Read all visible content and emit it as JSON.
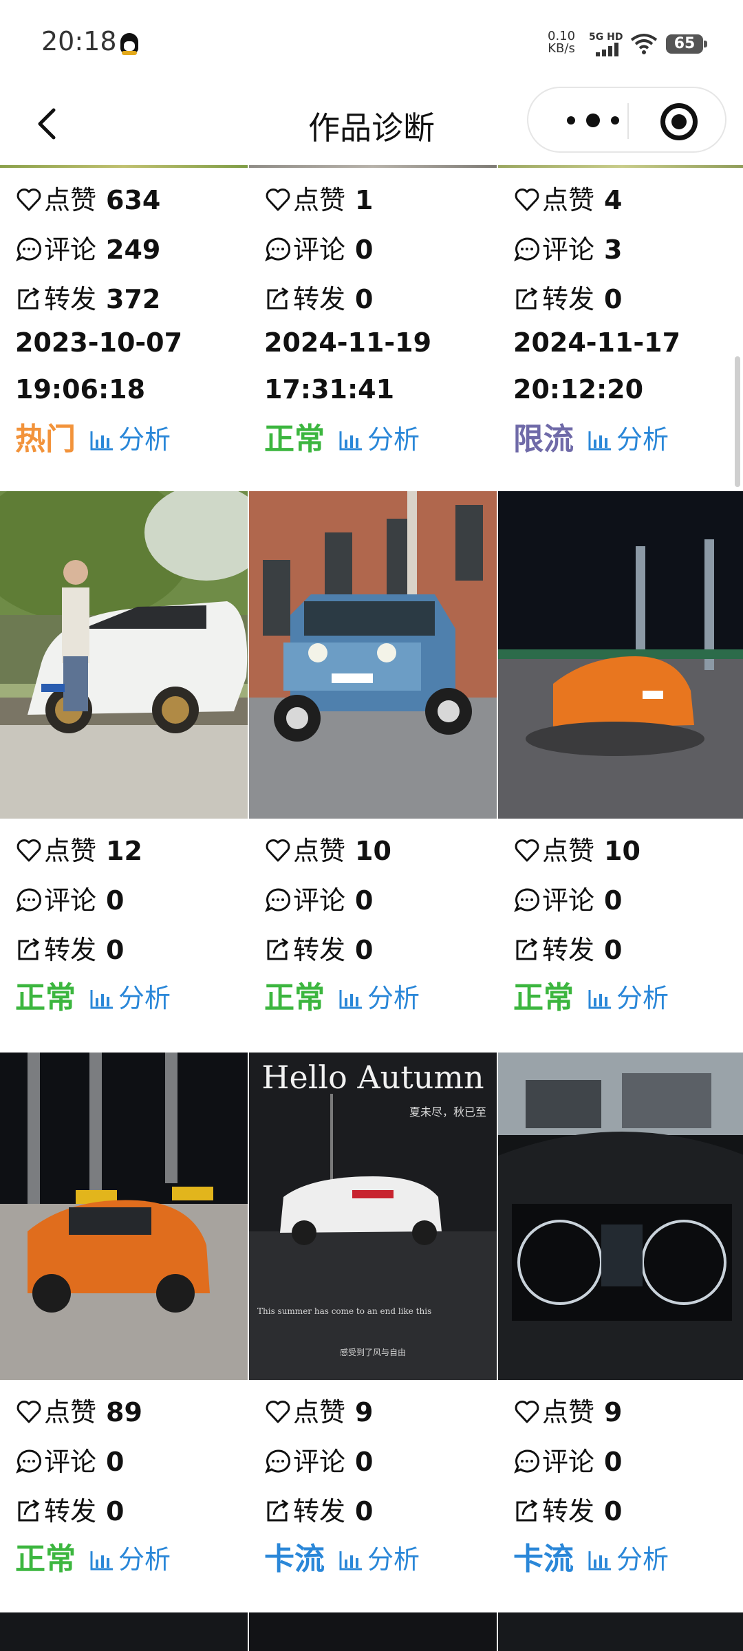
{
  "status_bar": {
    "time": "20:18",
    "net_speed_value": "0.10",
    "net_speed_unit": "KB/s",
    "network": "5G HD",
    "battery": "65"
  },
  "nav": {
    "title": "作品诊断"
  },
  "labels": {
    "likes": "点赞",
    "comments": "评论",
    "shares": "转发",
    "analyze": "分析"
  },
  "colors": {
    "hot": "#f2933b",
    "normal": "#3cb63f",
    "limited": "#6f6aa8",
    "stuck": "#2a87d8",
    "link": "#2a87d8"
  },
  "works": [
    {
      "likes": "634",
      "comments": "249",
      "shares": "372",
      "date": "2023-10-07",
      "time": "19:06:18",
      "status": "热门",
      "status_type": "hot"
    },
    {
      "likes": "1",
      "comments": "0",
      "shares": "0",
      "date": "2024-11-19",
      "time": "17:31:41",
      "status": "正常",
      "status_type": "normal"
    },
    {
      "likes": "4",
      "comments": "3",
      "shares": "0",
      "date": "2024-11-17",
      "time": "20:12:20",
      "status": "限流",
      "status_type": "limited"
    },
    {
      "likes": "12",
      "comments": "0",
      "shares": "0",
      "status": "正常",
      "status_type": "normal"
    },
    {
      "likes": "10",
      "comments": "0",
      "shares": "0",
      "status": "正常",
      "status_type": "normal"
    },
    {
      "likes": "10",
      "comments": "0",
      "shares": "0",
      "status": "正常",
      "status_type": "normal"
    },
    {
      "likes": "89",
      "comments": "0",
      "shares": "0",
      "status": "正常",
      "status_type": "normal"
    },
    {
      "likes": "9",
      "comments": "0",
      "shares": "0",
      "status": "卡流",
      "status_type": "stuck"
    },
    {
      "likes": "9",
      "comments": "0",
      "shares": "0",
      "status": "卡流",
      "status_type": "stuck"
    }
  ],
  "thumbnails": {
    "autumn_poster_title": "Hello Autumn",
    "autumn_poster_subtitle": "夏未尽，秋已至",
    "autumn_poster_caption": "This summer has come to an end like this",
    "autumn_poster_footer": "感受到了风与自由"
  }
}
